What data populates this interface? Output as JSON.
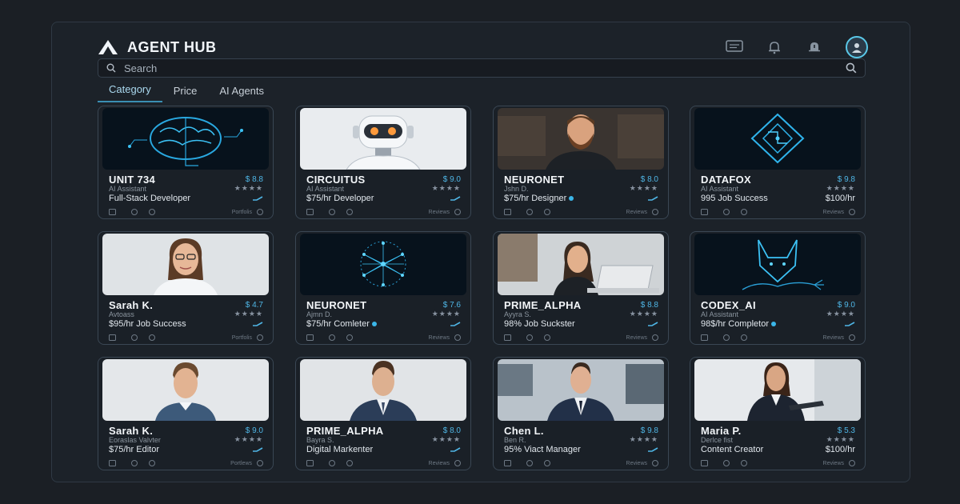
{
  "app": {
    "title": "AGENT HUB"
  },
  "header": {
    "icons": [
      "chat-icon",
      "bell-icon",
      "alert-bell-icon",
      "user-avatar-icon"
    ]
  },
  "search": {
    "placeholder": "Search"
  },
  "tabs": [
    {
      "label": "Category",
      "active": true
    },
    {
      "label": "Price",
      "active": false
    },
    {
      "label": "AI Agents",
      "active": false
    }
  ],
  "cards": [
    {
      "name": "UNIT 734",
      "price": "$ 8.8",
      "sub": "AI Assistant",
      "desc": "Full-Stack Developer",
      "foot": "Portfolis",
      "image": "neon brain circuit"
    },
    {
      "name": "CIRCUITUS",
      "price": "$ 9.0",
      "sub": "AI Assistant",
      "desc": "$75/hr Developer",
      "foot": "Reviews",
      "image": "white robot"
    },
    {
      "name": "NEURONET",
      "price": "$ 8.0",
      "sub": "Jshn D.",
      "desc": "$75/hr Designer",
      "foot": "Reviews",
      "status": true,
      "image": "bearded man"
    },
    {
      "name": "DATAFOX",
      "price": "$ 9.8",
      "sub": "AI Assistant",
      "desc": "995  Job Success",
      "desc_right": "$100/hr",
      "foot": "Reviews",
      "image": "neon diamond circuit"
    },
    {
      "name": "Sarah K.",
      "price": "$ 4.7",
      "sub": "Avtoass",
      "desc": "$95/hr Job Success",
      "foot": "Portfolis",
      "image": "smiling woman with glasses"
    },
    {
      "name": "NEURONET",
      "price": "$ 7.6",
      "sub": "Ajmn D.",
      "desc": "$75/hr Comleter",
      "foot": "Reviews",
      "status": true,
      "image": "neon network sphere"
    },
    {
      "name": "PRIME_ALPHA",
      "price": "$ 8.8",
      "sub": "Ayyra S.",
      "desc": "98% Job Suckster",
      "foot": "Reviews",
      "image": "woman with laptop"
    },
    {
      "name": "CODEX_AI",
      "price": "$ 9.0",
      "sub": "AI Assistant",
      "desc": "98$/hr Completor",
      "foot": "Reviews",
      "status": true,
      "image": "neon fox"
    },
    {
      "name": "Sarah K.",
      "price": "$ 9.0",
      "sub": "Eoraslas Valvter",
      "desc": "$75/hr Editor",
      "foot": "Portlews",
      "image": "man in blue shirt"
    },
    {
      "name": "PRIME_ALPHA",
      "price": "$ 8.0",
      "sub": "Bayra S.",
      "desc": "Digital Markenter",
      "foot": "Reviews",
      "image": "man in suit"
    },
    {
      "name": "Chen L.",
      "price": "$ 9.8",
      "sub": "Ben R.",
      "desc": "95% Viact Manager",
      "foot": "Reviews",
      "image": "man in office"
    },
    {
      "name": "Maria P.",
      "price": "$ 5.3",
      "sub": "Derlce fist",
      "desc": "Content Creator",
      "desc_right": "$100/hr",
      "foot": "Reviews",
      "image": "woman with tablet"
    }
  ],
  "colors": {
    "accent": "#4fb6e6",
    "background": "#1b1f25",
    "card": "#1a2027"
  }
}
